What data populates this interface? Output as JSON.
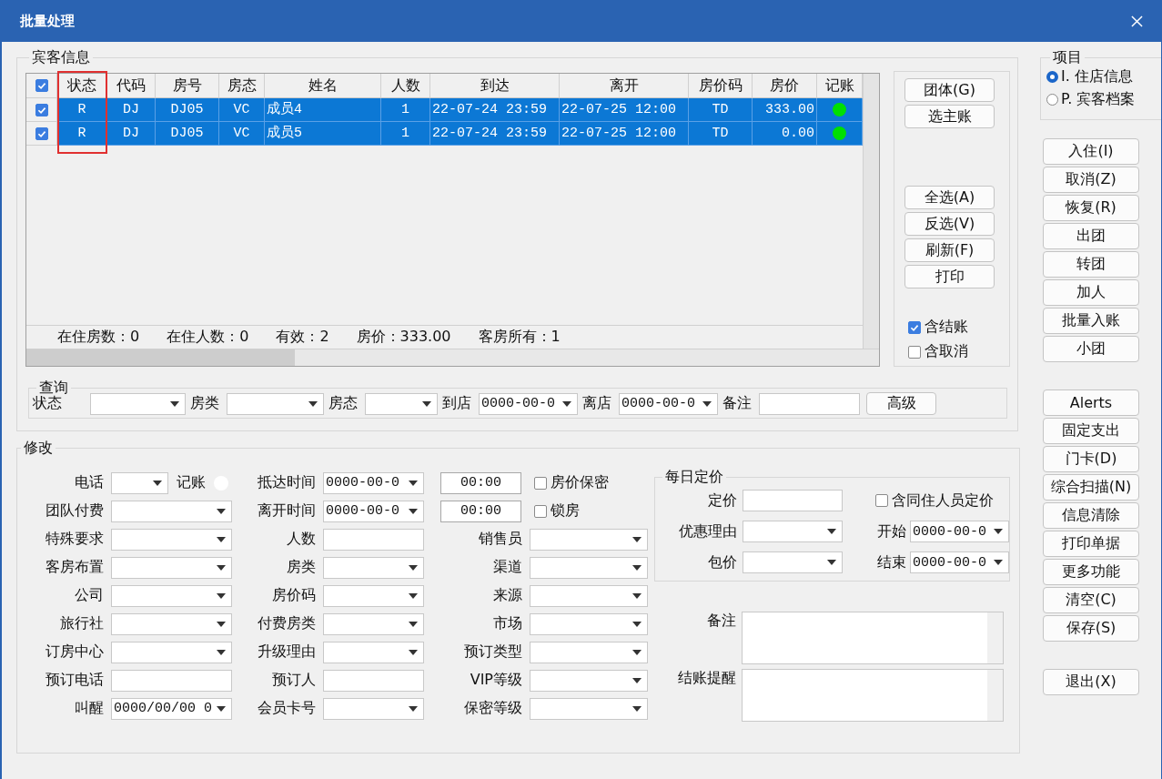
{
  "window": {
    "title": "批量处理"
  },
  "guest_info": {
    "legend": "宾客信息",
    "select_all": {
      "checked": true
    },
    "columns": [
      {
        "label": "状态",
        "highlighted": true
      },
      {
        "label": "代码",
        "highlighted": false
      },
      {
        "label": "房号",
        "highlighted": false
      },
      {
        "label": "房态",
        "highlighted": false
      },
      {
        "label": "姓名",
        "highlighted": false
      },
      {
        "label": "人数",
        "highlighted": false
      },
      {
        "label": "到达",
        "highlighted": false
      },
      {
        "label": "离开",
        "highlighted": false
      },
      {
        "label": "房价码",
        "highlighted": false
      },
      {
        "label": "房价",
        "highlighted": false
      },
      {
        "label": "记账",
        "highlighted": false
      }
    ],
    "rows": [
      {
        "checked": true,
        "selected": true,
        "cells": [
          "R",
          "DJ",
          "DJ05",
          "VC",
          "成员4",
          "1",
          "22-07-24 23:59",
          "22-07-25 12:00",
          "TD",
          "333.00"
        ],
        "color": "#00e000"
      },
      {
        "checked": true,
        "selected": true,
        "cells": [
          "R",
          "DJ",
          "DJ05",
          "VC",
          "成员5",
          "1",
          "22-07-24 23:59",
          "22-07-25 12:00",
          "TD",
          "0.00"
        ],
        "color": "#00e000"
      }
    ],
    "summary": [
      "在住房数：0",
      "在住人数：0",
      "有效：2",
      "房价：333.00",
      "客房所有：1"
    ]
  },
  "side_panel": {
    "button_groups": [
      [
        "团体(G)",
        "选主账"
      ],
      [
        "全选(A)",
        "反选(V)",
        "刷新(F)",
        "打印"
      ]
    ],
    "checkboxes": [
      {
        "label": "含结账",
        "checked": true
      },
      {
        "label": "含取消",
        "checked": false
      }
    ]
  },
  "query": {
    "legend": "查询",
    "fields": [
      {
        "label": "状态",
        "kind": "dropdown"
      },
      {
        "label": "房类",
        "kind": "dropdown"
      },
      {
        "label": "房态",
        "kind": "dropdown"
      },
      {
        "label": "到店",
        "kind": "dropdown",
        "value": "0000-00-0"
      },
      {
        "label": "离店",
        "kind": "dropdown",
        "value": "0000-00-0"
      },
      {
        "label": "备注",
        "kind": "text"
      }
    ],
    "button": "高级"
  },
  "modify": {
    "legend": "修改",
    "rows": [
      [
        {
          "kind": "dropdown_dot",
          "label": "电话",
          "dot_label": "记账",
          "dot_on": false
        },
        {
          "kind": "dropdown",
          "label": "抵达时间",
          "value": "0000-00-0"
        },
        {
          "kind": "time_check",
          "value": "00:00",
          "check_label": "房价保密",
          "checked": false
        }
      ],
      [
        {
          "kind": "dropdown",
          "label": "团队付费"
        },
        {
          "kind": "dropdown",
          "label": "离开时间",
          "value": "0000-00-0"
        },
        {
          "kind": "time_check",
          "value": "00:00",
          "check_label": "锁房",
          "checked": false
        }
      ],
      [
        {
          "kind": "dropdown",
          "label": "特殊要求"
        },
        {
          "kind": "text",
          "label": "人数"
        },
        {
          "kind": "dropdown",
          "label": "销售员"
        }
      ],
      [
        {
          "kind": "dropdown",
          "label": "客房布置"
        },
        {
          "kind": "dropdown",
          "label": "房类"
        },
        {
          "kind": "dropdown",
          "label": "渠道"
        }
      ],
      [
        {
          "kind": "dropdown",
          "label": "公司"
        },
        {
          "kind": "dropdown",
          "label": "房价码"
        },
        {
          "kind": "dropdown",
          "label": "来源"
        }
      ],
      [
        {
          "kind": "dropdown",
          "label": "旅行社"
        },
        {
          "kind": "dropdown",
          "label": "付费房类"
        },
        {
          "kind": "dropdown",
          "label": "市场"
        }
      ],
      [
        {
          "kind": "dropdown",
          "label": "订房中心"
        },
        {
          "kind": "dropdown",
          "label": "升级理由"
        },
        {
          "kind": "dropdown",
          "label": "预订类型"
        }
      ],
      [
        {
          "kind": "text",
          "label": "预订电话"
        },
        {
          "kind": "text",
          "label": "预订人"
        },
        {
          "kind": "dropdown",
          "label": "VIP等级"
        }
      ],
      [
        {
          "kind": "dropdown",
          "label": "叫醒",
          "value": "0000/00/00 0"
        },
        {
          "kind": "dropdown",
          "label": "会员卡号"
        },
        {
          "kind": "dropdown",
          "label": "保密等级"
        }
      ]
    ],
    "daily_pricing": {
      "legend": "每日定价",
      "rows": [
        [
          {
            "kind": "text",
            "label": "定价"
          },
          {
            "kind": "check",
            "label": "含同住人员定价",
            "checked": false
          }
        ],
        [
          {
            "kind": "dropdown",
            "label": "优惠理由"
          },
          {
            "kind": "dropdown",
            "label": "开始",
            "value": "0000-00-0"
          }
        ],
        [
          {
            "kind": "dropdown",
            "label": "包价"
          },
          {
            "kind": "dropdown",
            "label": "结束",
            "value": "0000-00-0"
          }
        ]
      ]
    },
    "notes": [
      {
        "label": "备注"
      },
      {
        "label": "结账提醒"
      }
    ]
  },
  "project": {
    "legend": "项目",
    "options": [
      {
        "label": "I. 住店信息",
        "selected": true
      },
      {
        "label": "P. 宾客档案",
        "selected": false
      }
    ]
  },
  "action_groups": [
    [
      "入住(I)",
      "取消(Z)",
      "恢复(R)",
      "出团",
      "转团",
      "加人",
      "批量入账",
      "小团"
    ],
    [
      "Alerts",
      "固定支出",
      "门卡(D)",
      "综合扫描(N)",
      "信息清除",
      "打印单据",
      "更多功能",
      "清空(C)",
      "保存(S)"
    ],
    [
      "退出(X)"
    ]
  ]
}
